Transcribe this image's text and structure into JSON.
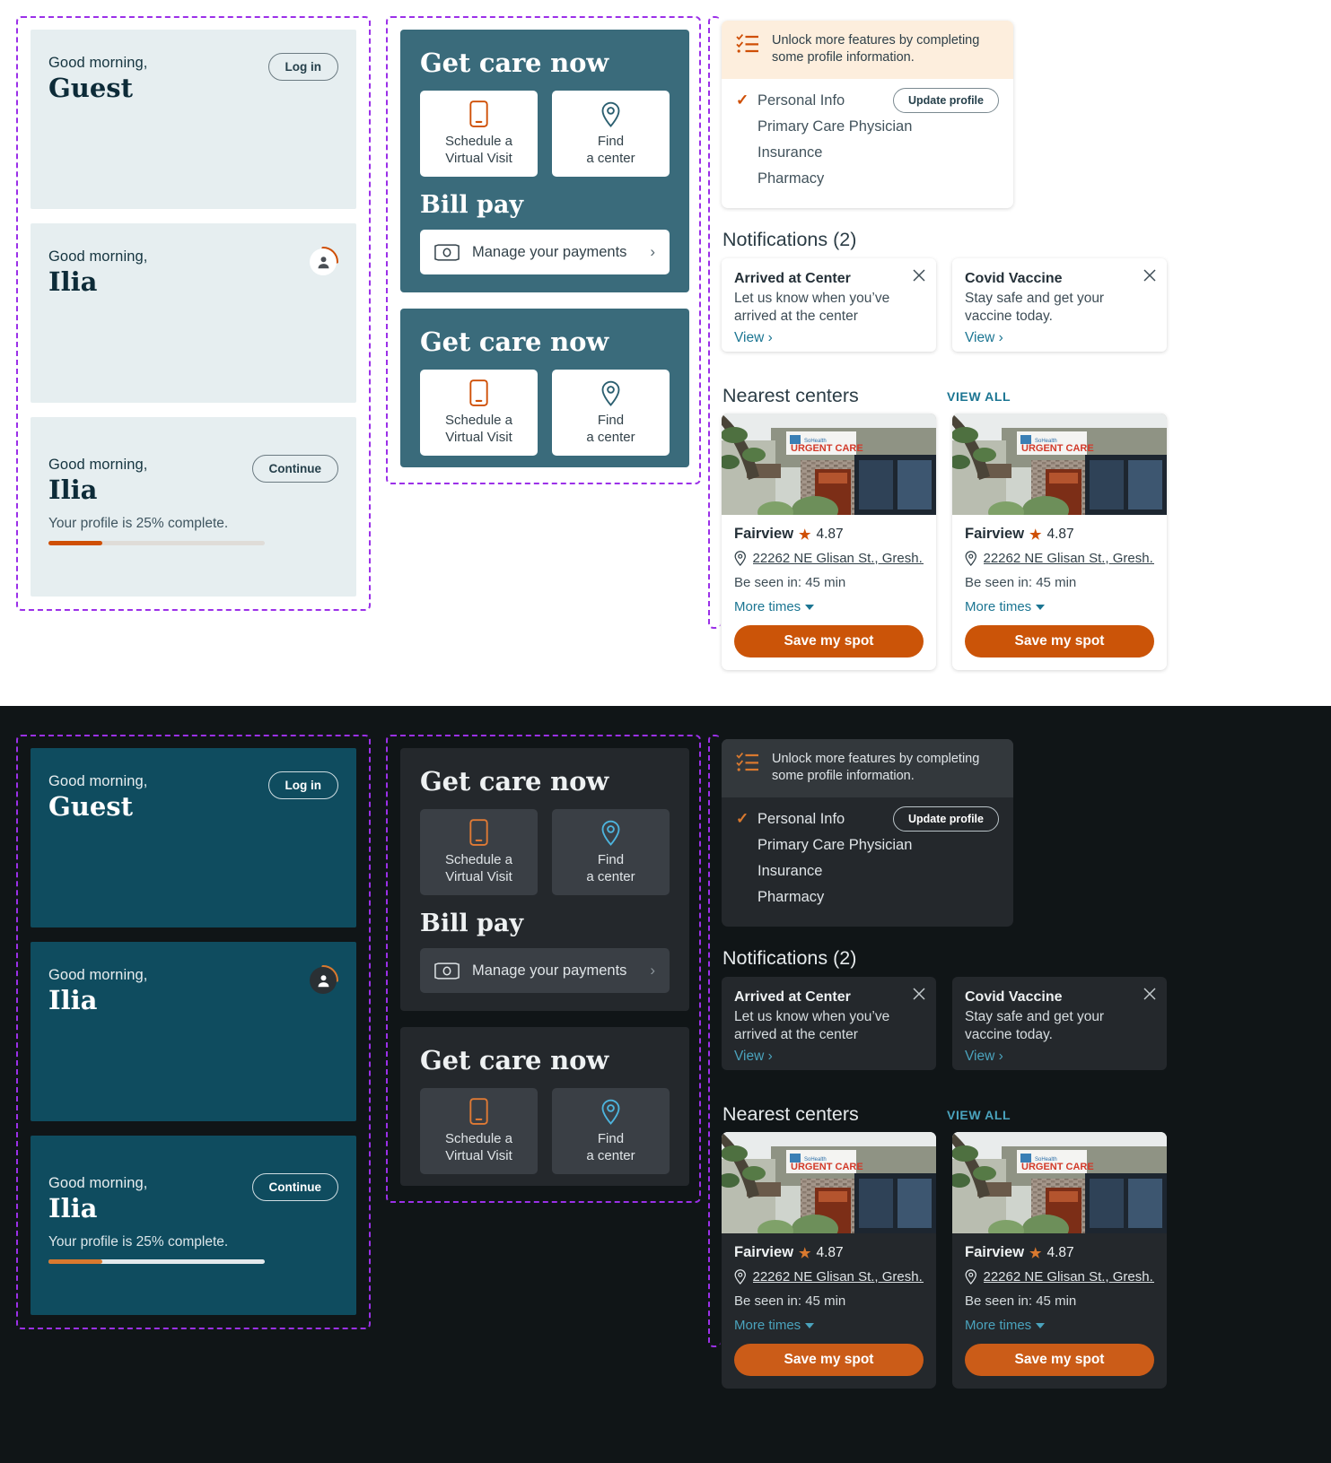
{
  "greeting": {
    "salutation": "Good morning,",
    "guest_name": "Guest",
    "user_name": "Ilia",
    "login_label": "Log in",
    "continue_label": "Continue",
    "profile_progress_text": "Your profile is 25% complete.",
    "profile_progress_percent": 25
  },
  "care": {
    "title": "Get care now",
    "virtual_visit_label": "Schedule a\nVirtual Visit",
    "virtual_visit_line1": "Schedule a",
    "virtual_visit_line2": "Virtual Visit",
    "find_center_line1": "Find",
    "find_center_line2": "a center",
    "bill_pay_title": "Bill pay",
    "manage_payments_label": "Manage your payments",
    "chevron": "›"
  },
  "profile_card": {
    "banner_line1": "Unlock more features by completing",
    "banner_line2": "some profile information.",
    "update_button": "Update profile",
    "items": [
      {
        "label": "Personal Info",
        "complete": true
      },
      {
        "label": "Primary Care Physician",
        "complete": false
      },
      {
        "label": "Insurance",
        "complete": false
      },
      {
        "label": "Pharmacy",
        "complete": false
      }
    ],
    "check_glyph": "✓"
  },
  "notifications": {
    "heading": "Notifications (2)",
    "items": [
      {
        "title": "Arrived at Center",
        "body_line1": "Let us know when you’ve",
        "body_line2": "arrived at the center",
        "link": "View ›"
      },
      {
        "title": "Covid Vaccine",
        "body_line1": "Stay safe and get your",
        "body_line2": "vaccine today.",
        "link": "View ›"
      }
    ]
  },
  "centers": {
    "heading": "Nearest centers",
    "view_all": "VIEW ALL",
    "items": [
      {
        "name": "Fairview",
        "rating": "4.87",
        "address": "22262 NE Glisan St., Gresh...",
        "wait": "Be seen in: 45 min",
        "more_times": "More times",
        "save_label": "Save my spot"
      },
      {
        "name": "Fairview",
        "rating": "4.87",
        "address": "22262 NE Glisan St., Gresh...",
        "wait": "Be seen in: 45 min",
        "more_times": "More times",
        "save_label": "Save my spot"
      }
    ],
    "star_glyph": "★"
  },
  "colors": {
    "accent_orange": "#cb5408",
    "teal_card": "#3a6b7b",
    "dark_teal_card": "#0f4c5f",
    "link_blue": "#1b7592",
    "annotation_purple": "#9b30e8",
    "light_card_bg": "#e6eef0",
    "dark_bg": "#101517",
    "dark_card": "#24282c"
  }
}
